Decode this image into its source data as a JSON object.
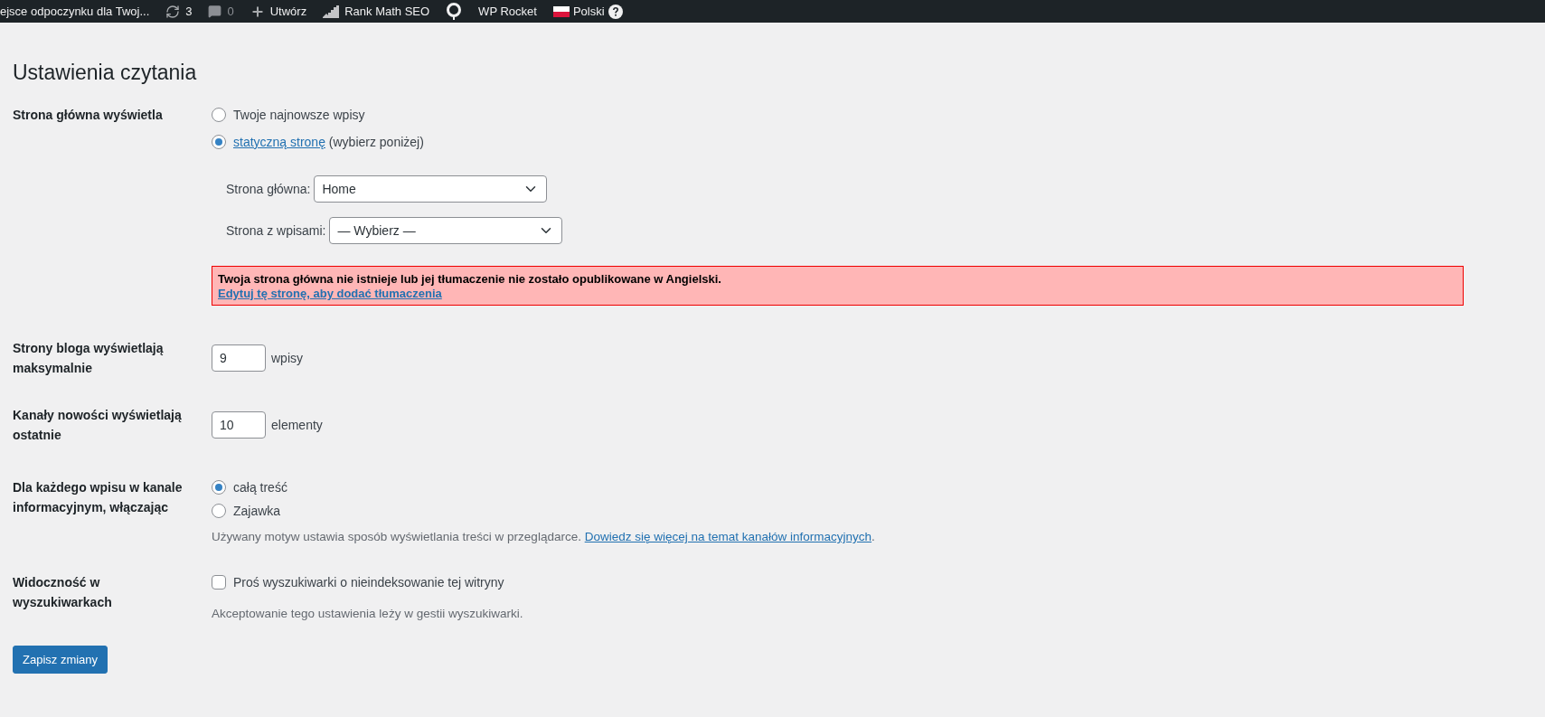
{
  "admin_bar": {
    "site_title": "ejsce odpoczynku dla Twoj...",
    "updates": "3",
    "comments": "0",
    "new": "Utwórz",
    "rank_math": "Rank Math SEO",
    "wp_rocket": "WP Rocket",
    "language": "Polski"
  },
  "page_title": "Ustawienia czytania",
  "front_page": {
    "label": "Strona główna wyświetla",
    "options": [
      {
        "label": "Twoje najnowsze wpisy",
        "selected": false
      },
      {
        "link": "statyczną stronę",
        "label": " (wybierz poniżej)",
        "selected": true
      }
    ],
    "selects": [
      {
        "label": "Strona główna:",
        "value": "Home"
      },
      {
        "label": "Strona z wpisami:",
        "value": "— Wybierz —"
      }
    ],
    "notice": {
      "text": "Twoja strona główna nie istnieje lub jej tłumaczenie nie zostało opublikowane w Angielski.",
      "link": "Edytuj tę stronę, aby dodać tłumaczenia"
    }
  },
  "number_rows": [
    {
      "label": "Strony bloga wyświetlają maksymalnie",
      "value": "9",
      "unit": "wpisy"
    },
    {
      "label": "Kanały nowości wyświetlają ostatnie",
      "value": "10",
      "unit": "elementy"
    }
  ],
  "feed_content": {
    "label": "Dla każdego wpisu w kanale informacyjnym, włączając",
    "options": [
      {
        "label": "całą treść",
        "selected": true
      },
      {
        "label": "Zajawka",
        "selected": false
      }
    ],
    "description": "Używany motyw ustawia sposób wyświetlania treści w przeglądarce. ",
    "description_link": "Dowiedz się więcej na temat kanałów informacyjnych",
    "description_end": "."
  },
  "search_visibility": {
    "label": "Widoczność w wyszukiwarkach",
    "checkbox": {
      "label": "Proś wyszukiwarki o nieindeksowanie tej witryny",
      "checked": false
    },
    "description": "Akceptowanie tego ustawienia leży w gestii wyszukiwarki."
  },
  "save_button": "Zapisz zmiany"
}
